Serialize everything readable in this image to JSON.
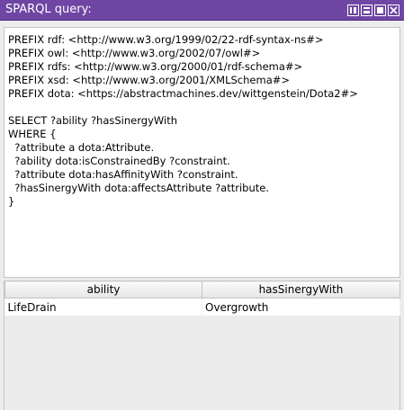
{
  "window": {
    "title": "SPARQL query:"
  },
  "icons": {
    "controls": [
      "split-panel-icon",
      "minimize-icon",
      "maximize-icon",
      "close-icon"
    ]
  },
  "query": {
    "text": "PREFIX rdf: <http://www.w3.org/1999/02/22-rdf-syntax-ns#>\nPREFIX owl: <http://www.w3.org/2002/07/owl#>\nPREFIX rdfs: <http://www.w3.org/2000/01/rdf-schema#>\nPREFIX xsd: <http://www.w3.org/2001/XMLSchema#>\nPREFIX dota: <https://abstractmachines.dev/wittgenstein/Dota2#>\n\nSELECT ?ability ?hasSinergyWith\nWHERE {\n  ?attribute a dota:Attribute.\n  ?ability dota:isConstrainedBy ?constraint.\n  ?attribute dota:hasAffinityWith ?constraint.\n  ?hasSinergyWith dota:affectsAttribute ?attribute.\n}"
  },
  "results": {
    "columns": [
      "ability",
      "hasSinergyWith"
    ],
    "rows": [
      [
        "LifeDrain",
        "Overgrowth"
      ]
    ]
  },
  "colors": {
    "titlebar": "#6f46a3",
    "background": "#ececec"
  }
}
